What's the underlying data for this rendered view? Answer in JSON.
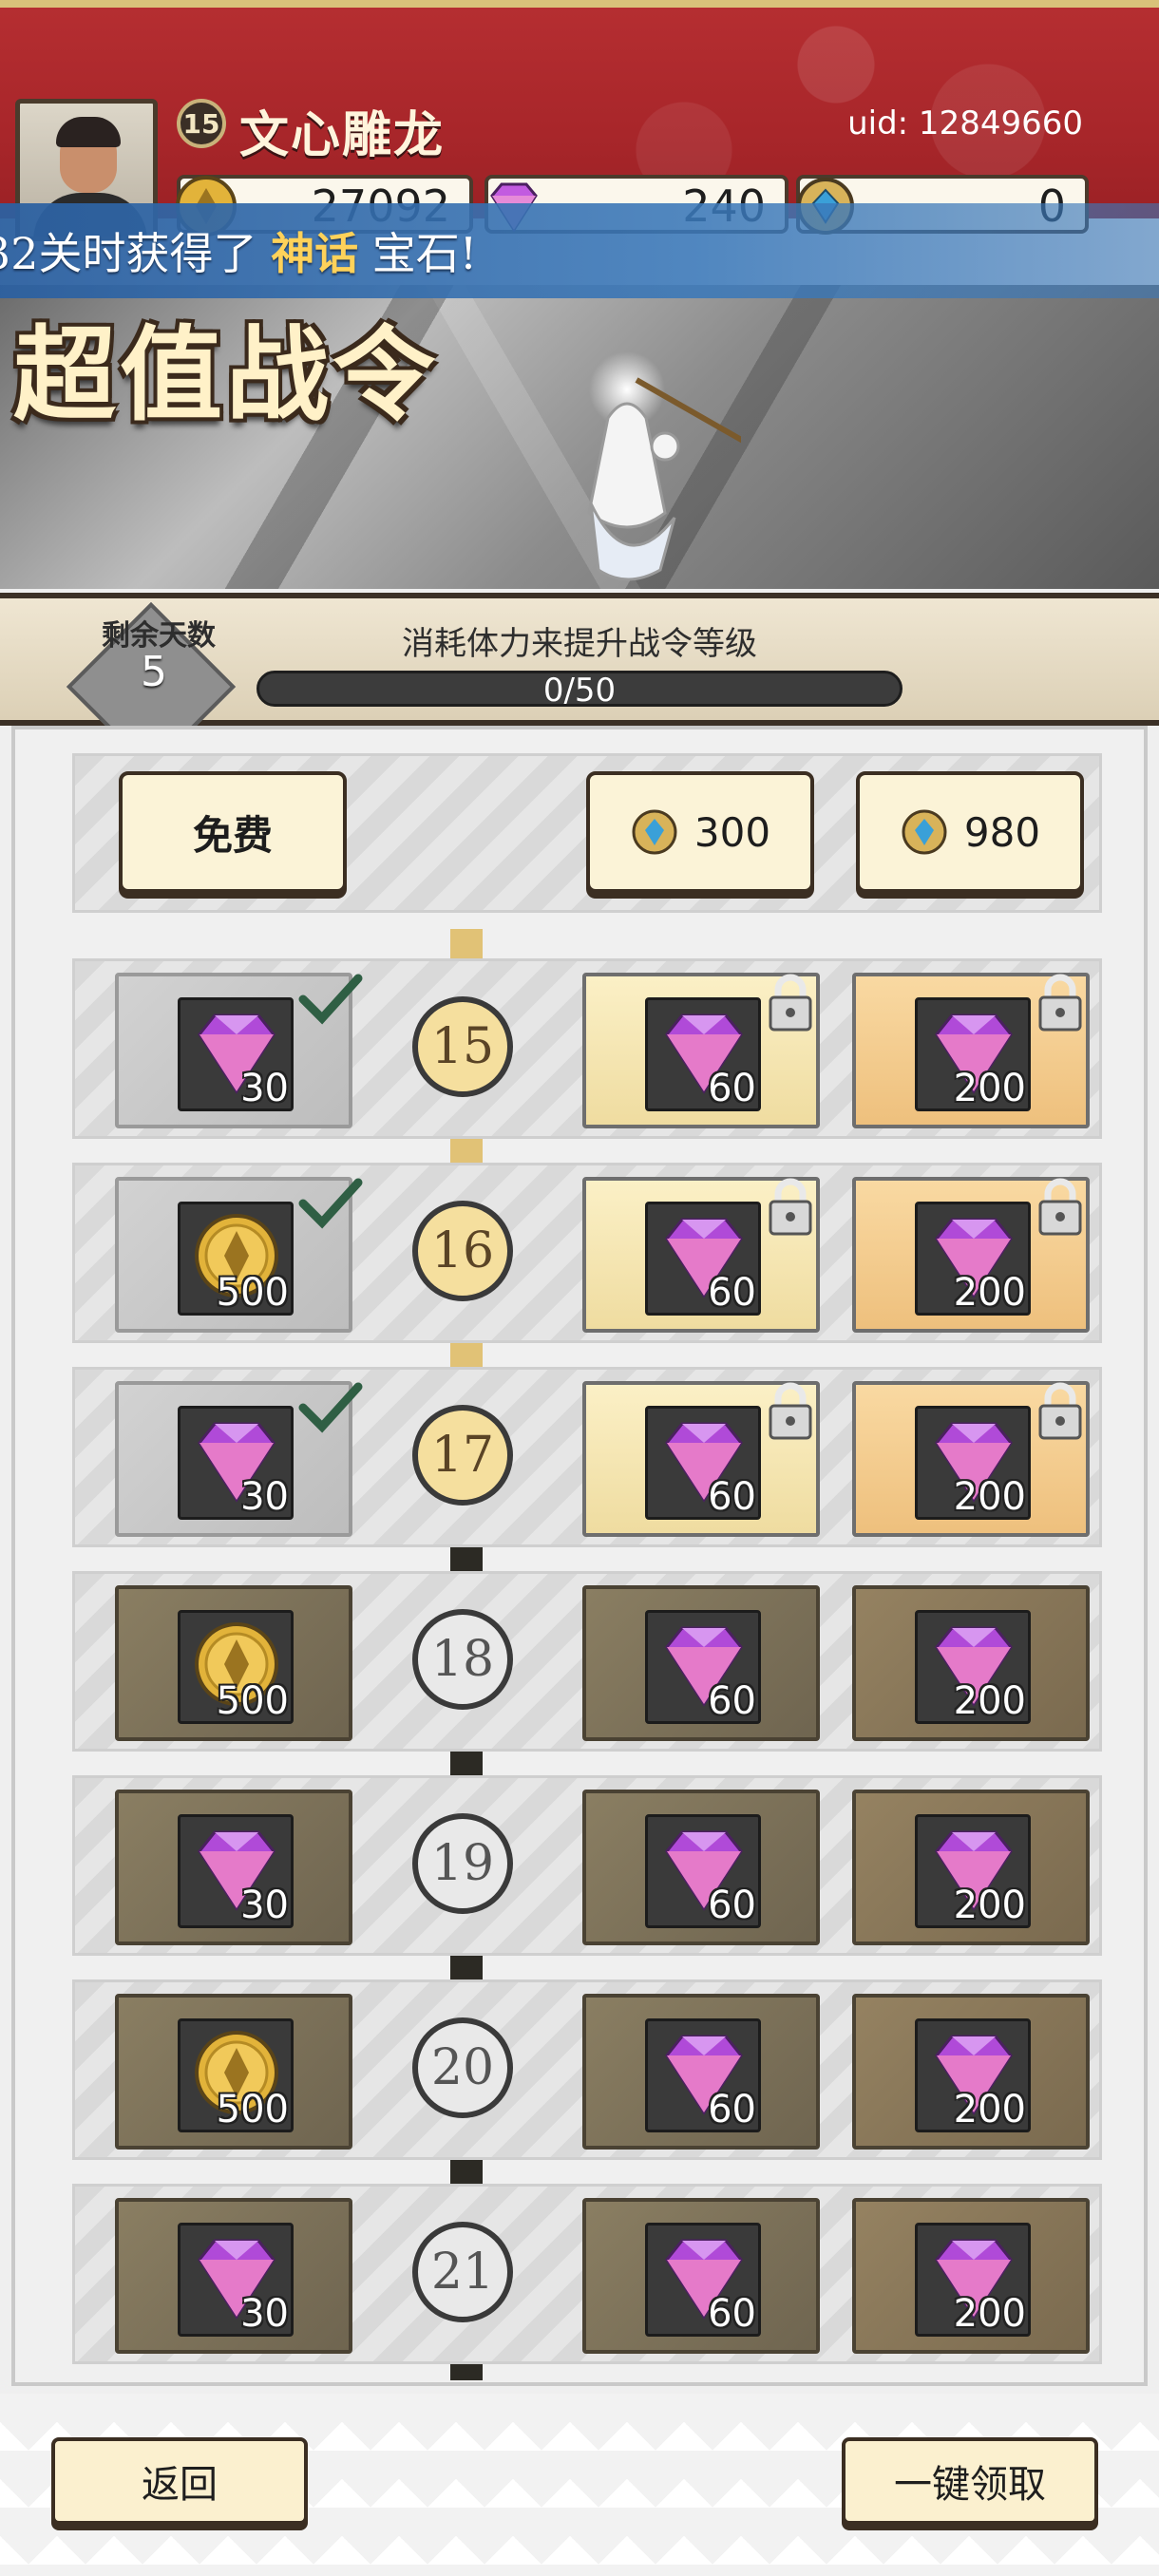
{
  "player": {
    "level": "15",
    "name": "文心雕龙",
    "uid": "uid: 12849660"
  },
  "currencies": {
    "gold": "27092",
    "gems": "240",
    "crystals": "0"
  },
  "marquee": {
    "before": "32关时获得了 ",
    "highlight": "神话",
    "after": " 宝石!"
  },
  "banner": {
    "title": "超值战令"
  },
  "progress": {
    "days_label": "剩余天数",
    "days_value": "5",
    "caption": "消耗体力来提升战令等级",
    "text": "0/50",
    "current": 0,
    "max": 50
  },
  "tiers": {
    "free": "免费",
    "tier1_price": "300",
    "tier2_price": "980"
  },
  "rows": [
    {
      "level": "15",
      "free_item": "gem-icon",
      "free_qty": "30",
      "free_claimed": true,
      "t1_qty": "60",
      "t2_qty": "200",
      "unlocked": true
    },
    {
      "level": "16",
      "free_item": "gold-coin-icon",
      "free_qty": "500",
      "free_claimed": true,
      "t1_qty": "60",
      "t2_qty": "200",
      "unlocked": true
    },
    {
      "level": "17",
      "free_item": "gem-icon",
      "free_qty": "30",
      "free_claimed": true,
      "t1_qty": "60",
      "t2_qty": "200",
      "unlocked": true
    },
    {
      "level": "18",
      "free_item": "gold-coin-icon",
      "free_qty": "500",
      "free_claimed": false,
      "t1_qty": "60",
      "t2_qty": "200",
      "unlocked": false
    },
    {
      "level": "19",
      "free_item": "gem-icon",
      "free_qty": "30",
      "free_claimed": false,
      "t1_qty": "60",
      "t2_qty": "200",
      "unlocked": false
    },
    {
      "level": "20",
      "free_item": "gold-coin-icon",
      "free_qty": "500",
      "free_claimed": false,
      "t1_qty": "60",
      "t2_qty": "200",
      "unlocked": false
    },
    {
      "level": "21",
      "free_item": "gem-icon",
      "free_qty": "30",
      "free_claimed": false,
      "t1_qty": "60",
      "t2_qty": "200",
      "unlocked": false
    }
  ],
  "buttons": {
    "back": "返回",
    "claim_all": "一键领取"
  },
  "colors": {
    "header_red": "#a8262a",
    "gem_purple": "#b04ad8",
    "gold": "#e2b33a",
    "marquee_blue": "#3a78b9"
  }
}
